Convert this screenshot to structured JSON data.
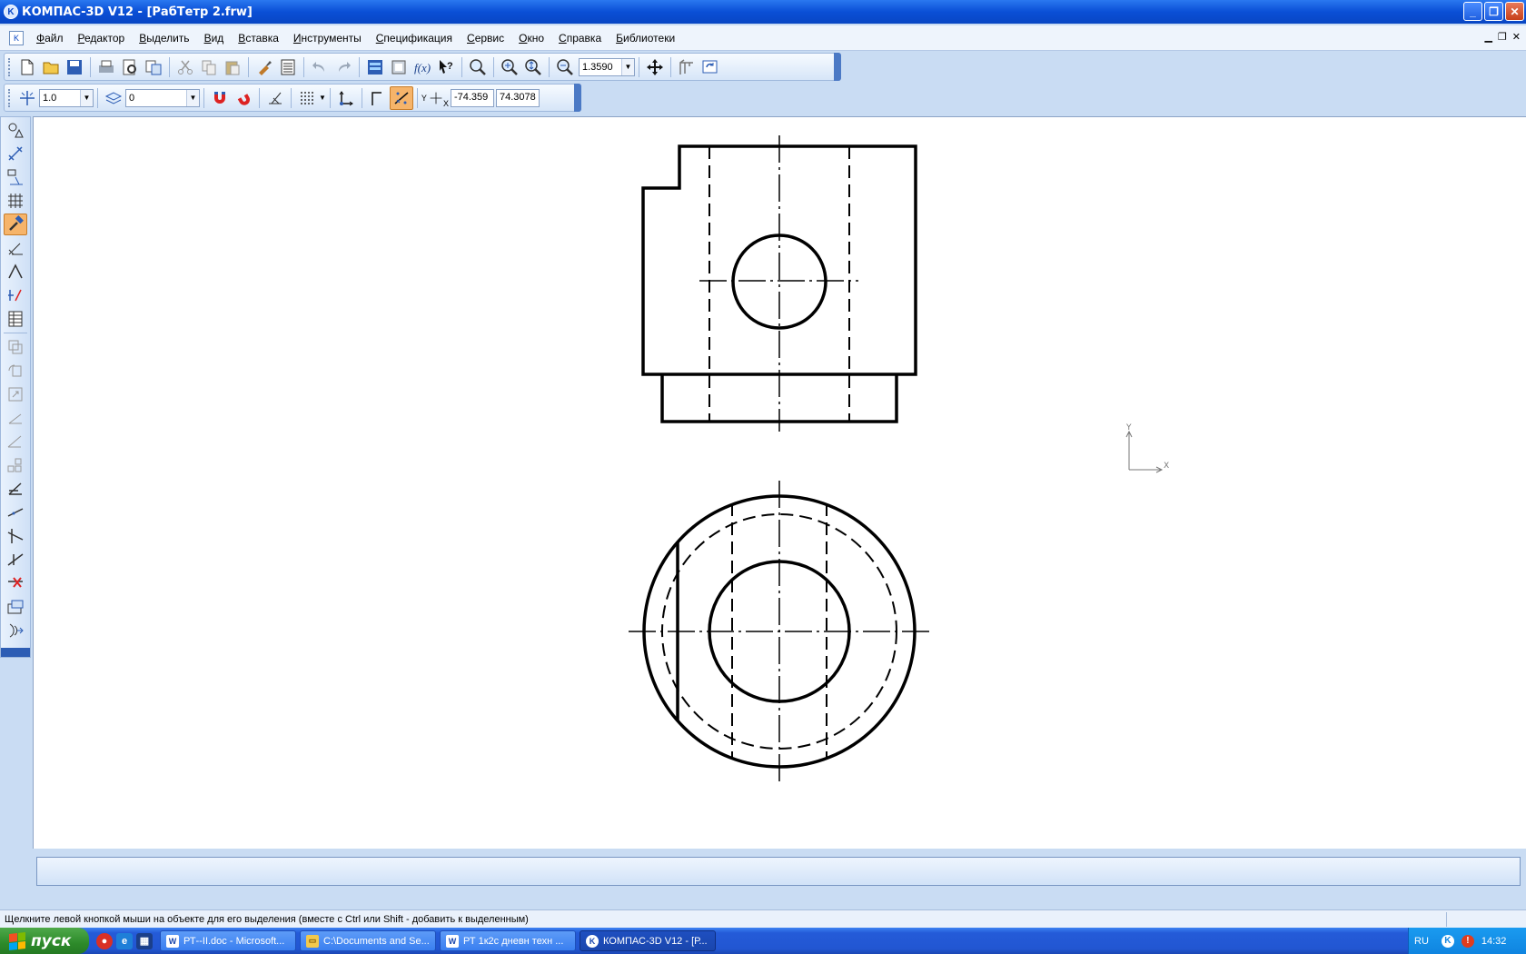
{
  "window": {
    "title": "КОМПАС-3D V12 - [РабТетр 2.frw]",
    "icon": "kompas-logo-icon"
  },
  "menu": {
    "items": [
      "Файл",
      "Редактор",
      "Выделить",
      "Вид",
      "Вставка",
      "Инструменты",
      "Спецификация",
      "Сервис",
      "Окно",
      "Справка",
      "Библиотеки"
    ]
  },
  "toolbar_standard": {
    "zoom_value": "1.3590"
  },
  "toolbar_current_state": {
    "step_value": "1.0",
    "layer_value": "0",
    "coord_x": "-74.359",
    "coord_y": "74.3078",
    "coord_label_y": "Y",
    "coord_label_x": "X"
  },
  "canvas": {
    "axis_y_label": "Y",
    "axis_x_label": "X"
  },
  "status": {
    "message": "Щелкните левой кнопкой мыши на объекте для его выделения (вместе с Ctrl или Shift - добавить к выделенным)"
  },
  "taskbar": {
    "start_label": "пуск",
    "tasks": [
      {
        "label": "РТ--II.doc - Microsoft...",
        "icon": "word-icon"
      },
      {
        "label": "C:\\Documents and Se...",
        "icon": "folder-icon"
      },
      {
        "label": "РТ 1к2с дневн техн ...",
        "icon": "word-icon"
      },
      {
        "label": "КОМПАС-3D V12 - [Р...",
        "icon": "kompas-icon"
      }
    ],
    "tray": {
      "lang": "RU",
      "time": "14:32"
    }
  },
  "colors": {
    "accent_active": "#f6b46a",
    "title_bar": "#0a4fd6",
    "taskbar": "#245bd8",
    "start_button": "#2d8a2a"
  }
}
